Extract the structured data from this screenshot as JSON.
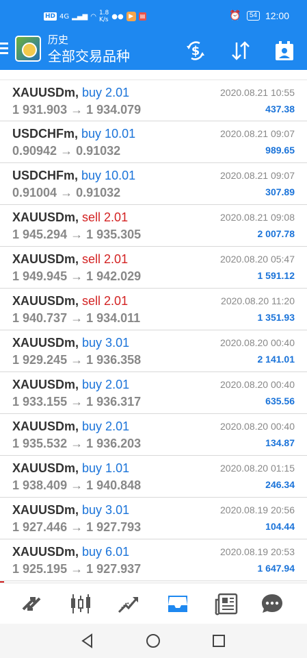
{
  "status_bar": {
    "hd": "HD",
    "net": "4G",
    "speed_value": "1.8",
    "speed_unit": "K/s",
    "battery": "54",
    "time": "12:00"
  },
  "header": {
    "title": "历史",
    "subtitle": "全部交易品种"
  },
  "colors": {
    "primary": "#1e88f0",
    "buy": "#1a73d9",
    "sell": "#d32222"
  },
  "trades": [
    {
      "symbol": "XAUUSDm,",
      "side": "buy",
      "volume": "buy 2.01",
      "open": "1 931.903",
      "close": "1 934.079",
      "datetime": "2020.08.21 10:55",
      "profit": "437.38"
    },
    {
      "symbol": "USDCHFm,",
      "side": "buy",
      "volume": "buy 10.01",
      "open": "0.90942",
      "close": "0.91032",
      "datetime": "2020.08.21 09:07",
      "profit": "989.65"
    },
    {
      "symbol": "USDCHFm,",
      "side": "buy",
      "volume": "buy 10.01",
      "open": "0.91004",
      "close": "0.91032",
      "datetime": "2020.08.21 09:07",
      "profit": "307.89"
    },
    {
      "symbol": "XAUUSDm,",
      "side": "sell",
      "volume": "sell 2.01",
      "open": "1 945.294",
      "close": "1 935.305",
      "datetime": "2020.08.21 09:08",
      "profit": "2 007.78"
    },
    {
      "symbol": "XAUUSDm,",
      "side": "sell",
      "volume": "sell 2.01",
      "open": "1 949.945",
      "close": "1 942.029",
      "datetime": "2020.08.20 05:47",
      "profit": "1 591.12"
    },
    {
      "symbol": "XAUUSDm,",
      "side": "sell",
      "volume": "sell 2.01",
      "open": "1 940.737",
      "close": "1 934.011",
      "datetime": "2020.08.20 11:20",
      "profit": "1 351.93"
    },
    {
      "symbol": "XAUUSDm,",
      "side": "buy",
      "volume": "buy 3.01",
      "open": "1 929.245",
      "close": "1 936.358",
      "datetime": "2020.08.20 00:40",
      "profit": "2 141.01"
    },
    {
      "symbol": "XAUUSDm,",
      "side": "buy",
      "volume": "buy 2.01",
      "open": "1 933.155",
      "close": "1 936.317",
      "datetime": "2020.08.20 00:40",
      "profit": "635.56"
    },
    {
      "symbol": "XAUUSDm,",
      "side": "buy",
      "volume": "buy 2.01",
      "open": "1 935.532",
      "close": "1 936.203",
      "datetime": "2020.08.20 00:40",
      "profit": "134.87"
    },
    {
      "symbol": "XAUUSDm,",
      "side": "buy",
      "volume": "buy 1.01",
      "open": "1 938.409",
      "close": "1 940.848",
      "datetime": "2020.08.20 01:15",
      "profit": "246.34"
    },
    {
      "symbol": "XAUUSDm,",
      "side": "buy",
      "volume": "buy 3.01",
      "open": "1 927.446",
      "close": "1 927.793",
      "datetime": "2020.08.19 20:56",
      "profit": "104.44"
    },
    {
      "symbol": "XAUUSDm,",
      "side": "buy",
      "volume": "buy 6.01",
      "open": "1 925.195",
      "close": "1 927.937",
      "datetime": "2020.08.19 20:53",
      "profit": "1 647.94"
    }
  ],
  "arrow": "→",
  "bottom_nav": [
    "quotes-icon",
    "chart-icon",
    "trade-icon",
    "history-icon",
    "news-icon",
    "chat-icon"
  ],
  "active_tab": "history-icon"
}
